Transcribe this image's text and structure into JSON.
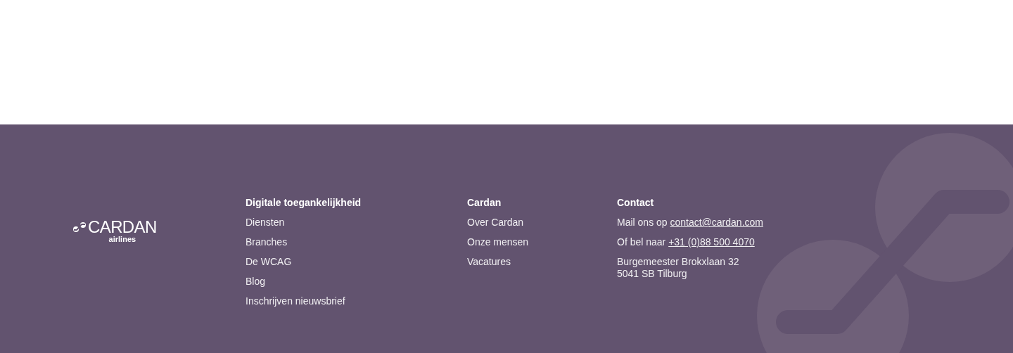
{
  "logo": {
    "name": "CARDAN",
    "tagline": "airlines"
  },
  "columns": [
    {
      "heading": "Digitale toegankelijkheid",
      "links": [
        "Diensten",
        "Branches",
        "De WCAG",
        "Blog",
        "Inschrijven nieuwsbrief"
      ]
    },
    {
      "heading": "Cardan",
      "links": [
        "Over Cardan",
        "Onze mensen",
        "Vacatures"
      ]
    }
  ],
  "contact": {
    "heading": "Contact",
    "lines": [
      {
        "kind": "link",
        "text": "Mail ons op",
        "link": "contact@cardan.com"
      },
      {
        "kind": "link",
        "text": "Of bel naar",
        "link": "+31 (0)88 500 4070"
      },
      {
        "kind": "address",
        "lines": [
          "Burgemeester Brokxlaan 32",
          "5041 SB Tilburg"
        ]
      }
    ]
  }
}
